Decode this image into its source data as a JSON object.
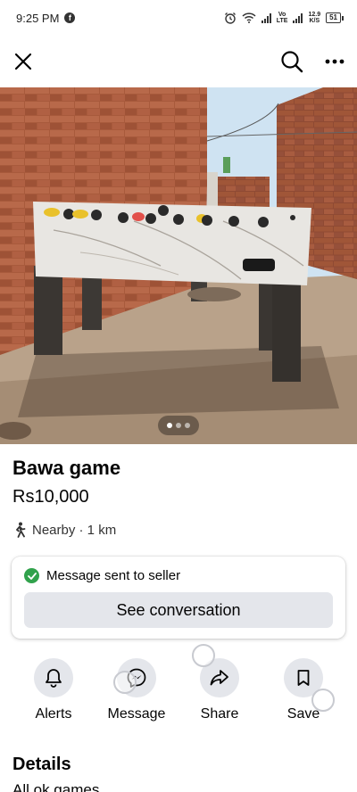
{
  "status_bar": {
    "time": "9:25 PM",
    "app_badge": "f",
    "network_label_top": "Vo",
    "network_label_bottom": "LTE",
    "speed_top": "12.9",
    "speed_bottom": "K/S",
    "battery": "51"
  },
  "nav": {
    "close_icon": "close-icon",
    "search_icon": "search-icon",
    "more_icon": "more-icon"
  },
  "carousel": {
    "total_photos": 3,
    "active_photo": 1
  },
  "listing": {
    "title": "Bawa game",
    "price": "Rs10,000",
    "location": "Nearby · 1 km"
  },
  "message_card": {
    "status": "Message sent to seller",
    "button": "See conversation"
  },
  "actions": [
    {
      "label": "Alerts",
      "icon": "bell-icon"
    },
    {
      "label": "Message",
      "icon": "messenger-icon"
    },
    {
      "label": "Share",
      "icon": "share-icon"
    },
    {
      "label": "Save",
      "icon": "bookmark-icon"
    }
  ],
  "details": {
    "heading": "Details",
    "description": "All ok games"
  },
  "colors": {
    "success": "#31a24c",
    "button_bg": "#e4e6eb",
    "text": "#050505"
  }
}
